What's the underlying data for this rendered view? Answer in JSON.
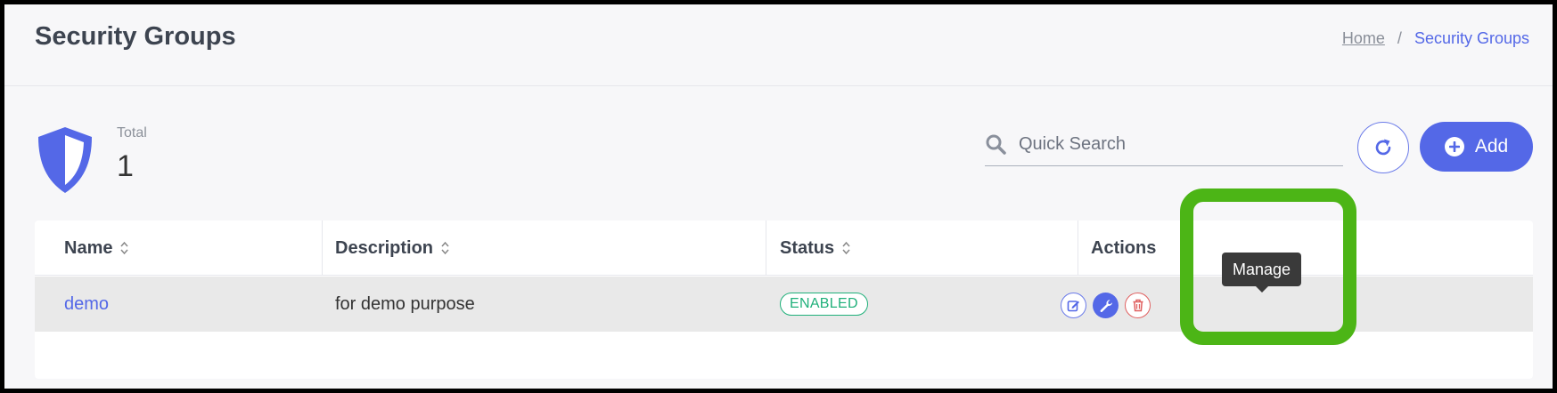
{
  "header": {
    "title": "Security Groups",
    "breadcrumb": {
      "home": "Home",
      "separator": "/",
      "current": "Security Groups"
    }
  },
  "summary": {
    "label": "Total",
    "value": "1",
    "icon": "shield-icon"
  },
  "toolbar": {
    "search_placeholder": "Quick Search",
    "refresh_icon": "refresh-icon",
    "add_label": "Add"
  },
  "table": {
    "columns": [
      "Name",
      "Description",
      "Status",
      "Actions"
    ],
    "rows": [
      {
        "name": "demo",
        "description": "for demo purpose",
        "status": "ENABLED"
      }
    ]
  },
  "tooltip": {
    "text": "Manage"
  },
  "colors": {
    "accent": "#5468e7",
    "success": "#1fb07a",
    "danger": "#e06060",
    "highlight": "#4cb516"
  }
}
